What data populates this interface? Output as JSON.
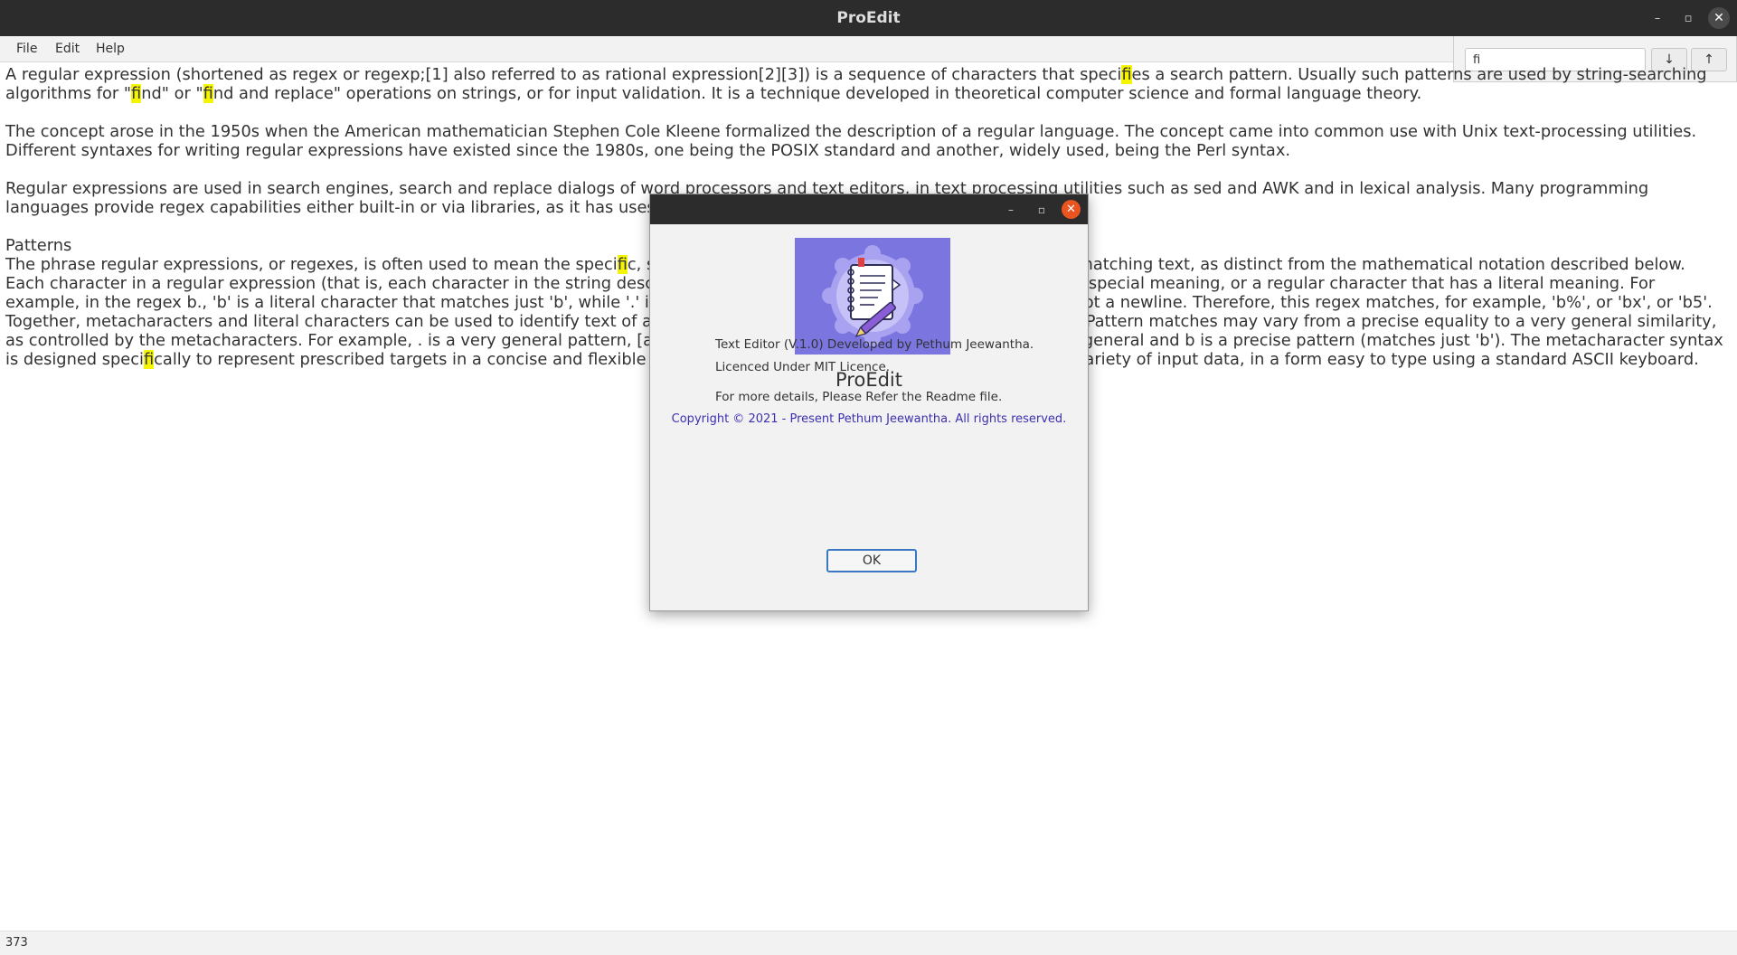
{
  "window": {
    "title": "ProEdit",
    "minimize_glyph": "–",
    "maximize_glyph": "▫",
    "close_glyph": "✕"
  },
  "menu": {
    "items": [
      {
        "label": "File"
      },
      {
        "label": "Edit"
      },
      {
        "label": "Help"
      }
    ]
  },
  "find": {
    "value": "fi",
    "down_glyph": "↓",
    "up_glyph": "↑"
  },
  "document": {
    "paragraphs": [
      {
        "segments": [
          {
            "t": "A regular expression (shortened as regex or regexp;[1] also referred to as rational expression[2][3]) is a sequence of characters that speci"
          },
          {
            "t": "fi",
            "hl": true
          },
          {
            "t": "es a search pattern. Usually such patterns are used by string-searching algorithms for \""
          },
          {
            "t": "fi",
            "hl": true
          },
          {
            "t": "nd\" or \""
          },
          {
            "t": "fi",
            "hl": true
          },
          {
            "t": "nd and replace\" operations on strings, or for input validation. It is a technique developed in theoretical computer science and formal language theory."
          }
        ]
      },
      {
        "segments": [
          {
            "t": "The concept arose in the 1950s when the American mathematician Stephen Cole Kleene formalized the description of a regular language. The concept came into common use with Unix text-processing utilities. Different syntaxes for writing regular expressions have existed since the 1980s, one being the POSIX standard and another, widely used, being the Perl syntax."
          }
        ]
      },
      {
        "segments": [
          {
            "t": "Regular expressions are used in search engines, search and replace dialogs of word processors and text editors, in text processing utilities such as sed and AWK and in lexical analysis. Many programming languages provide regex capabilities either built-in or via libraries, as it has uses in many situations."
          }
        ]
      },
      {
        "tight": true,
        "segments": [
          {
            "t": "Patterns"
          }
        ]
      },
      {
        "segments": [
          {
            "t": "The phrase regular expressions, or regexes, is often used to mean the speci"
          },
          {
            "t": "fi",
            "hl": true
          },
          {
            "t": "c, standard textual syntax for representing patterns for matching text, as distinct from the mathematical notation described below. Each character in a regular expression (that is, each character in the string describing its pattern) is either a metacharacter, having a special meaning, or a regular character that has a literal meaning. For example, in the regex b., 'b' is a literal character that matches just 'b', while '.' is a metacharacter that matches every character except a newline. Therefore, this regex matches, for example, 'b%', or 'bx', or 'b5'. Together, metacharacters and literal characters can be used to identify text of a given pattern or process a number of instances of it. Pattern matches may vary from a precise equality to a very general similarity, as controlled by the metacharacters. For example, . is a very general pattern, [a-z] (match all lower case letters from 'a' to 'z') is less general and b is a precise pattern (matches just 'b'). The metacharacter syntax is designed speci"
          },
          {
            "t": "fi",
            "hl": true
          },
          {
            "t": "cally to represent prescribed targets in a concise and flexible way to direct the automation of text processing of a variety of input data, in a form easy to type using a standard ASCII keyboard."
          }
        ]
      }
    ]
  },
  "status": {
    "value": "373"
  },
  "dialog": {
    "app_name": "ProEdit",
    "line1": "Text Editor (V.1.0) Developed by Pethum Jeewantha.",
    "line2": "Licenced Under MIT Licence.",
    "line3": "For more details, Please Refer the Readme file.",
    "copyright": "Copyright © 2021 - Present Pethum Jeewantha. All rights reserved.",
    "ok_label": "OK",
    "minimize_glyph": "–",
    "maximize_glyph": "▫",
    "close_glyph": "✕"
  },
  "colors": {
    "title_bar": "#2c2c2c",
    "highlight": "#f5f500",
    "dialog_close": "#e95420",
    "copyright_text": "#3c30b0",
    "logo_background": "#7b75e0",
    "ok_focus": "#3b78c4"
  }
}
